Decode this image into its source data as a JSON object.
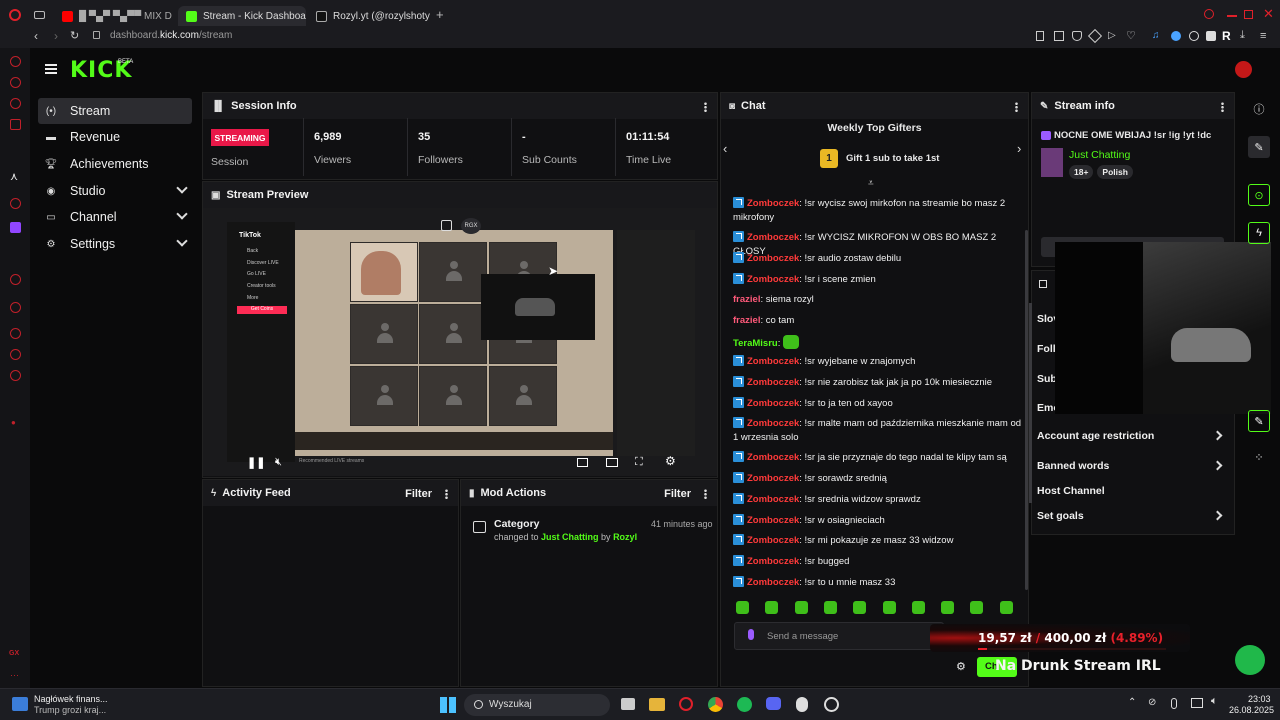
{
  "browser": {
    "tabs": [
      {
        "label": "█ ▀▄▀ ▀▄▀▀ MIX D"
      },
      {
        "label": "Stream - Kick Dashboard"
      },
      {
        "label": "Rozyl.yt (@rozylshoty"
      }
    ],
    "address": {
      "domain_prefix": "dashboard.",
      "domain": "kick.com",
      "path": "/stream"
    }
  },
  "header": {
    "logo": "KICK",
    "logo_badge": "BETA"
  },
  "nav": {
    "items": [
      {
        "label": "Stream",
        "icon": "broadcast-icon"
      },
      {
        "label": "Revenue",
        "icon": "card-icon"
      },
      {
        "label": "Achievements",
        "icon": "trophy-icon"
      },
      {
        "label": "Studio",
        "icon": "palette-icon"
      },
      {
        "label": "Channel",
        "icon": "tv-icon"
      },
      {
        "label": "Settings",
        "icon": "gear-icon"
      }
    ]
  },
  "session": {
    "title": "Session Info",
    "status_badge": "STREAMING",
    "status_label": "Session",
    "stats": [
      {
        "value": "6,989",
        "label": "Viewers"
      },
      {
        "value": "35",
        "label": "Followers"
      },
      {
        "value": "-",
        "label": "Sub Counts"
      },
      {
        "value": "01:11:54",
        "label": "Time Live"
      }
    ]
  },
  "preview": {
    "title": "Stream Preview",
    "overlay_text": "RGX",
    "tiktok_menu": [
      "TikTok",
      "Back",
      "Discover LIVE",
      "Go LIVE",
      "Creator tools",
      "More",
      "Get Coins"
    ],
    "bottom_status": "Recommended LIVE streams"
  },
  "activity": {
    "title": "Activity Feed",
    "filter": "Filter"
  },
  "mod": {
    "title": "Mod Actions",
    "filter": "Filter",
    "entry": {
      "heading": "Category",
      "time": "41 minutes ago",
      "text_before": "changed to ",
      "category": "Just Chatting",
      "text_mid": " by ",
      "user": "Rozyl"
    }
  },
  "chat": {
    "title": "Chat",
    "gifters_title": "Weekly Top Gifters",
    "gifters_rank": "1",
    "gifters_cta": "Gift 1 sub to take 1st",
    "placeholder": "Send a message",
    "send_label": "Chat",
    "messages": [
      {
        "user": "Zomboczek",
        "color": "#ff3a3a",
        "badge": true,
        "text": "!sr wycisz swoj mirkofon na streamie bo masz 2 mikrofony"
      },
      {
        "user": "Zomboczek",
        "color": "#ff3a3a",
        "badge": true,
        "text": "!sr WYCISZ MIKROFON W OBS BO MASZ 2 GŁOSY"
      },
      {
        "user": "Zomboczek",
        "color": "#ff3a3a",
        "badge": true,
        "text": "!sr audio zostaw debilu"
      },
      {
        "user": "Zomboczek",
        "color": "#ff3a3a",
        "badge": true,
        "text": "!sr i scene zmien"
      },
      {
        "user": "fraziel",
        "color": "#ff5a7a",
        "badge": false,
        "text": "siema rozyl"
      },
      {
        "user": "fraziel",
        "color": "#ff5a7a",
        "badge": false,
        "text": "co tam"
      },
      {
        "user": "TeraMisru",
        "color": "#53fc18",
        "badge": false,
        "text": ""
      },
      {
        "user": "Zomboczek",
        "color": "#ff3a3a",
        "badge": true,
        "text": "!sr wyjebane w znajomych"
      },
      {
        "user": "Zomboczek",
        "color": "#ff3a3a",
        "badge": true,
        "text": "!sr nie zarobisz tak jak ja po 10k miesiecznie"
      },
      {
        "user": "Zomboczek",
        "color": "#ff3a3a",
        "badge": true,
        "text": "!sr to ja ten od xayoo"
      },
      {
        "user": "Zomboczek",
        "color": "#ff3a3a",
        "badge": true,
        "text": "!sr malte mam od października mieszkanie mam od 1 wrzesnia solo"
      },
      {
        "user": "Zomboczek",
        "color": "#ff3a3a",
        "badge": true,
        "text": "!sr ja sie przyznaje do tego nadal te klipy tam są"
      },
      {
        "user": "Zomboczek",
        "color": "#ff3a3a",
        "badge": true,
        "text": "!sr sorawdz srednią"
      },
      {
        "user": "Zomboczek",
        "color": "#ff3a3a",
        "badge": true,
        "text": "!sr srednia widzow sprawdz"
      },
      {
        "user": "Zomboczek",
        "color": "#ff3a3a",
        "badge": true,
        "text": "!sr w osiagnieciach"
      },
      {
        "user": "Zomboczek",
        "color": "#ff3a3a",
        "badge": true,
        "text": "!sr mi pokazuje ze masz 33 widzow"
      },
      {
        "user": "Zomboczek",
        "color": "#ff3a3a",
        "badge": true,
        "text": "!sr bugged"
      },
      {
        "user": "Zomboczek",
        "color": "#ff3a3a",
        "badge": true,
        "text": "!sr to u mnie masz 33"
      }
    ]
  },
  "stream_info": {
    "title": "Stream info",
    "stream_title": "NOCNE OME WBIJAJ !sr !ig !yt !dc",
    "category": "Just Chatting",
    "tags": [
      "18+",
      "Polish"
    ]
  },
  "settings_list": {
    "partial_rows": [
      "Slov",
      "Follo",
      "Sub",
      "Emo"
    ],
    "rows": [
      {
        "label": "Account age restriction",
        "chevron": true
      },
      {
        "label": "Banned words",
        "chevron": true
      },
      {
        "label": "Host Channel",
        "chevron": false
      },
      {
        "label": "Set goals",
        "chevron": true
      }
    ]
  },
  "overlay": {
    "goal_current": "19,57 zł",
    "goal_sep": "/",
    "goal_target": "400,00 zł",
    "goal_percent": "(4.89%)",
    "goal_fraction": 0.0489,
    "stream_label": "Na Drunk Stream IRL",
    "chat_btn": "Ch"
  },
  "taskbar": {
    "news_title": "Nagłówek finans...",
    "news_sub": "Trump grozi kraj...",
    "search": "Wyszukaj",
    "time": "23:03",
    "date": "26.08.2025"
  },
  "colors": {
    "accent": "#53fc18",
    "streaming": "#e91848",
    "mod_badge": "#2a8fd8",
    "goal_red": "#e6202a"
  }
}
